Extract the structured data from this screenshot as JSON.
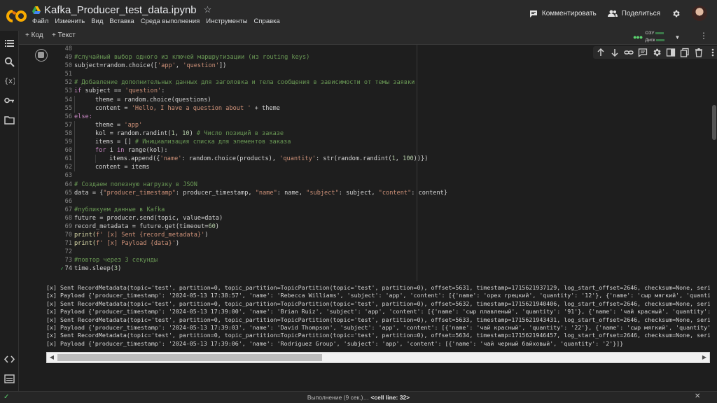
{
  "header": {
    "title": "Kafka_Producer_test_data.ipynb",
    "menu": [
      "Файл",
      "Изменить",
      "Вид",
      "Вставка",
      "Среда выполнения",
      "Инструменты",
      "Справка"
    ],
    "comment_label": "Комментировать",
    "share_label": "Поделиться"
  },
  "toolbar": {
    "add_code": "+ Код",
    "add_text": "+ Текст",
    "ram_label": "ОЗУ",
    "disk_label": "Диск"
  },
  "code": {
    "line_numbers": [
      "48",
      "49",
      "50",
      "51",
      "52",
      "53",
      "54",
      "55",
      "56",
      "57",
      "58",
      "59",
      "60",
      "61",
      "62",
      "63",
      "64",
      "65",
      "66",
      "67",
      "68",
      "69",
      "70",
      "71",
      "72",
      "73",
      "74"
    ],
    "active_line": "74",
    "l49": "#случайный выбор одного из ключей маршрутизации (из routing keys)",
    "l50_a": "subject=random.choice([",
    "l50_s1": "'app'",
    "l50_b": ", ",
    "l50_s2": "'question'",
    "l50_c": "])",
    "l52": "# Добавление дополнительных данных для заголовка и тела сообщения в зависимости от темы заявки",
    "l53_kw": "if",
    "l53_a": " subject == ",
    "l53_s": "'question'",
    "l53_b": ":",
    "l54": "theme = random.choice(questions)",
    "l55_a": "content = ",
    "l55_s": "'Hello, I have a question about '",
    "l55_b": " + theme",
    "l56": "else:",
    "l57_a": "theme = ",
    "l57_s": "'app'",
    "l58_a": "kol = random.randint(",
    "l58_n1": "1",
    "l58_b": ", ",
    "l58_n2": "10",
    "l58_c": ") ",
    "l58_com": "# Число позиций в заказе",
    "l59_a": "items = [] ",
    "l59_com": "# Инициализация списка для элементов заказа",
    "l60_kw": "for",
    "l60_a": " i ",
    "l60_kw2": "in",
    "l60_b": " range(kol):",
    "l61_a": "items.append({",
    "l61_s1": "'name'",
    "l61_b": ": random.choice(products), ",
    "l61_s2": "'quantity'",
    "l61_c": ": str(random.randint(",
    "l61_n1": "1",
    "l61_d": ", ",
    "l61_n2": "100",
    "l61_e": "))})",
    "l62": "content = items",
    "l64": "# Создаем полезную нагрузку в JSON",
    "l65_a": "data = {",
    "l65_s1": "\"producer_timestamp\"",
    "l65_b": ": producer_timestamp, ",
    "l65_s2": "\"name\"",
    "l65_c": ": name, ",
    "l65_s3": "\"subject\"",
    "l65_d": ": subject, ",
    "l65_s4": "\"content\"",
    "l65_e": ": content}",
    "l67": "#публикуем данные в Kafka",
    "l68": "future = producer.send(topic, value=data)",
    "l69_a": "record_metadata = future.get(timeout=",
    "l69_n": "60",
    "l69_b": ")",
    "l70_a": "print(",
    "l70_s": "f' [x] Sent {record_metadata}'",
    "l70_b": ")",
    "l71_a": "print(",
    "l71_s": "f' [x] Payload {data}'",
    "l71_b": ")",
    "l73": "#повтор через 3 секунды",
    "l74_a": "time.sleep(",
    "l74_n": "3",
    "l74_b": ")"
  },
  "output": {
    "lines": [
      "[x] Sent RecordMetadata(topic='test', partition=0, topic_partition=TopicPartition(topic='test', partition=0), offset=5631, timestamp=1715621937129, log_start_offset=2646, checksum=None, seri",
      "[x] Payload {'producer_timestamp': '2024-05-13 17:38:57', 'name': 'Rebecca Williams', 'subject': 'app', 'content': [{'name': 'орех грецкий', 'quantity': '12'}, {'name': 'сыр мягкий', 'quanti",
      "[x] Sent RecordMetadata(topic='test', partition=0, topic_partition=TopicPartition(topic='test', partition=0), offset=5632, timestamp=1715621940406, log_start_offset=2646, checksum=None, seri",
      "[x] Payload {'producer_timestamp': '2024-05-13 17:39:00', 'name': 'Brian Ruiz', 'subject': 'app', 'content': [{'name': 'сыр плавленый', 'quantity': '91'}, {'name': 'чай красный', 'quantity':",
      "[x] Sent RecordMetadata(topic='test', partition=0, topic_partition=TopicPartition(topic='test', partition=0), offset=5633, timestamp=1715621943431, log_start_offset=2646, checksum=None, seri",
      "[x] Payload {'producer_timestamp': '2024-05-13 17:39:03', 'name': 'David Thompson', 'subject': 'app', 'content': [{'name': 'чай красный', 'quantity': '22'}, {'name': 'сыр мягкий', 'quantity'",
      "[x] Sent RecordMetadata(topic='test', partition=0, topic_partition=TopicPartition(topic='test', partition=0), offset=5634, timestamp=1715621946457, log_start_offset=2646, checksum=None, seri",
      "[x] Payload {'producer_timestamp': '2024-05-13 17:39:06', 'name': 'Rodriguez Group', 'subject': 'app', 'content': [{'name': 'чай черный байховый', 'quantity': '2'}]}"
    ]
  },
  "status": {
    "text": "Выполнение (9 сек.)…",
    "cell_line": "<cell line: 32>"
  },
  "colors": {
    "accent_green": "#5bd36f",
    "colab_orange": "#f9ab00"
  },
  "icons": [
    "colab-logo-icon",
    "drive-icon",
    "star-icon",
    "comment-icon",
    "share-icon",
    "gear-icon",
    "avatar",
    "toc-icon",
    "search-icon",
    "variables-icon",
    "key-icon",
    "folder-icon",
    "code-snippets-icon",
    "terminal-icon",
    "arrow-up-icon",
    "arrow-down-icon",
    "link-icon",
    "comment-cell-icon",
    "cell-settings-icon",
    "mirror-cell-icon",
    "copy-icon",
    "delete-icon",
    "more-icon",
    "chevron-down-icon",
    "run-stop-icon"
  ]
}
